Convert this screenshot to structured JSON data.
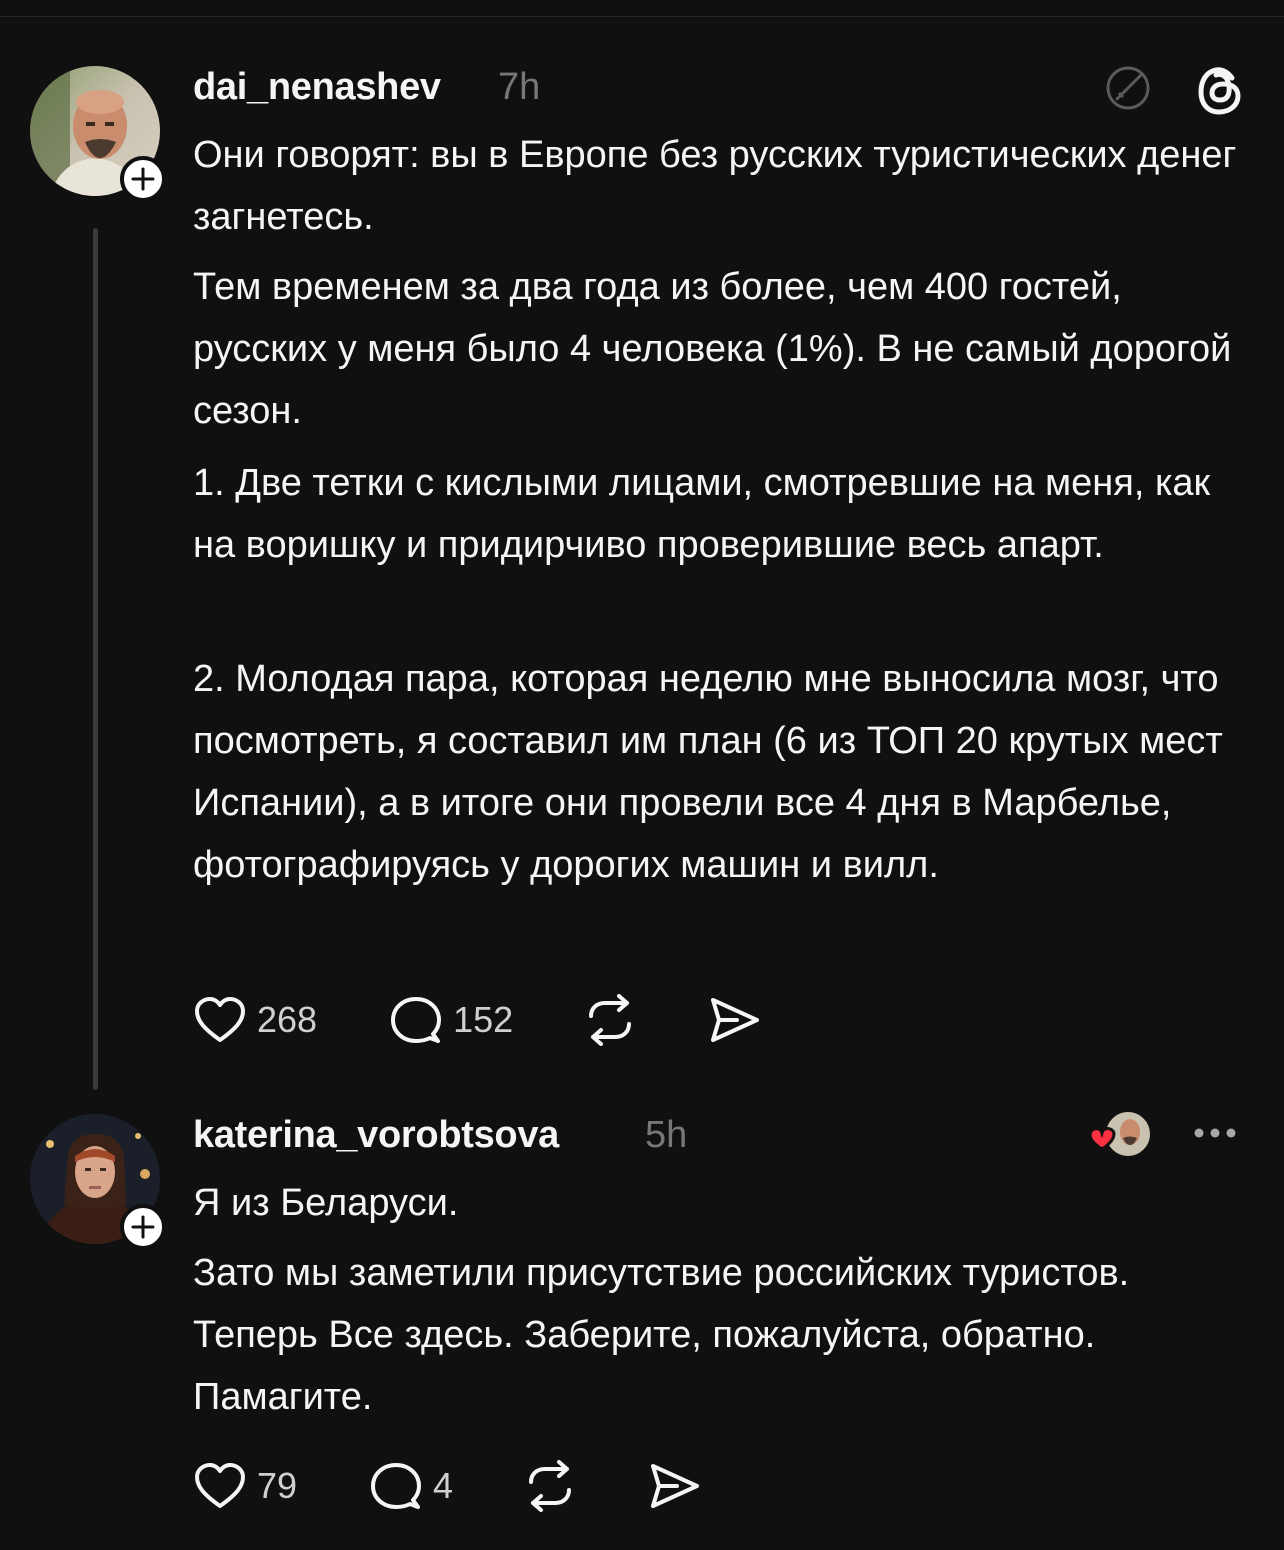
{
  "posts": [
    {
      "username": "dai_nenashev",
      "time": "7h",
      "paragraphs": [
        "Они говорят: вы в Европе без русских туристических денег загнетесь.",
        "Тем временем за два года из более, чем 400 гостей, русских у меня было 4 человека (1%). В не самый дорогой сезон.",
        "1. Две тетки с кислыми лицами, смотревшие на меня, как на воришку и придирчиво проверившие весь апарт.",
        "2. Молодая пара, которая неделю мне выносила мозг, что посмотреть, я составил им план (6 из ТОП 20 крутых мест Испании), а в итоге они провели все 4 дня в Марбелье, фотографируясь у дорогих машин и вилл."
      ],
      "likes": "268",
      "replies": "152"
    },
    {
      "username": "katerina_vorobtsova",
      "time": "5h",
      "paragraphs": [
        "Я из Беларуси.",
        "Зато мы заметили присутствие российских туристов. Теперь Все здесь. Заберите, пожалуйста, обратно. Памагите."
      ],
      "likes": "79",
      "replies": "4"
    }
  ],
  "icons": {
    "edit": "edit-pencil-icon",
    "threads": "threads-logo-icon",
    "like": "heart-icon",
    "reply": "comment-bubble-icon",
    "repost": "repost-icon",
    "share": "share-send-icon",
    "more": "more-dots-icon",
    "liked_by_author": "liked-by-author-badge"
  },
  "colors": {
    "background": "#101010",
    "text": "#f3f5f7",
    "secondary": "#777777",
    "heart_red": "#ff3040"
  }
}
